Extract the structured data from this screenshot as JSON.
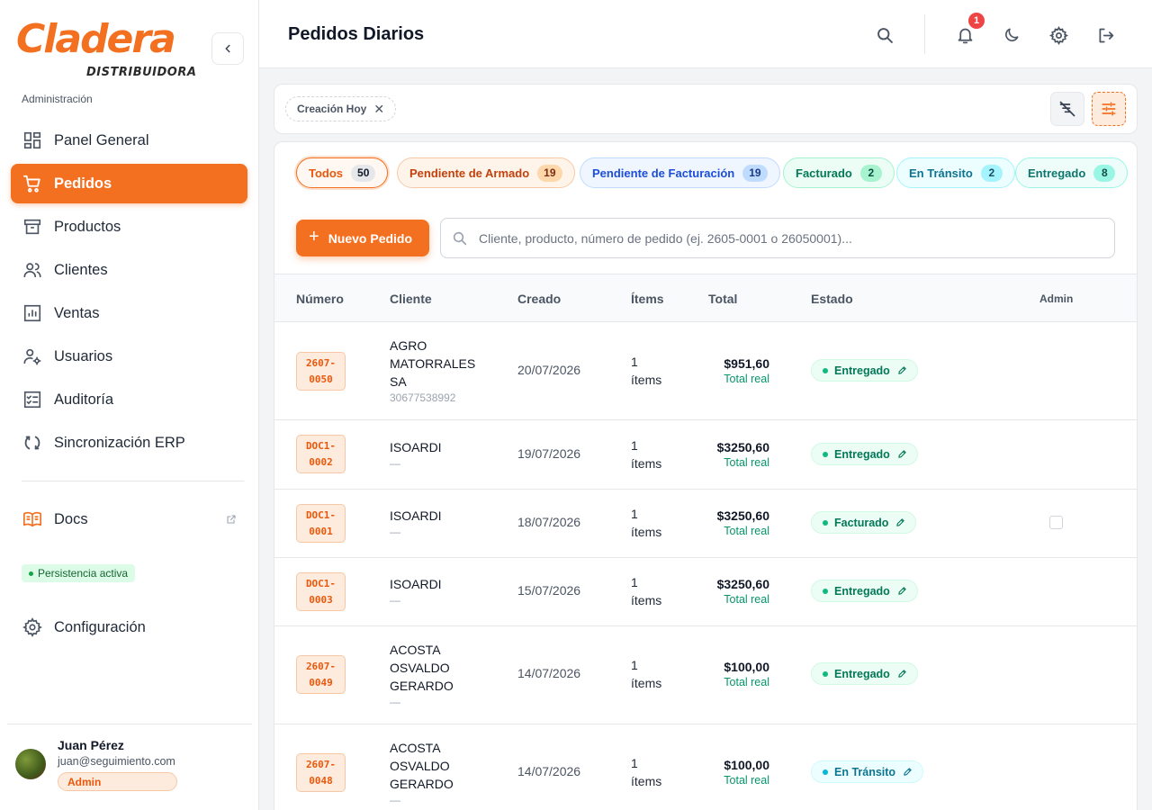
{
  "brand": {
    "name": "Cladera",
    "sub": "DISTRIBUIDORA"
  },
  "sidebar": {
    "section_label": "Administración",
    "items": [
      {
        "label": "Panel General",
        "icon": "dashboard-icon"
      },
      {
        "label": "Pedidos",
        "icon": "cart-icon",
        "active": true
      },
      {
        "label": "Productos",
        "icon": "archive-icon"
      },
      {
        "label": "Clientes",
        "icon": "users-icon"
      },
      {
        "label": "Ventas",
        "icon": "chart-icon"
      },
      {
        "label": "Usuarios",
        "icon": "user-gear-icon"
      },
      {
        "label": "Auditoría",
        "icon": "checklist-icon"
      },
      {
        "label": "Sincronización ERP",
        "icon": "sync-icon"
      }
    ],
    "docs": {
      "label": "Docs",
      "icon": "book-icon"
    },
    "persist_badge": "Persistencia activa",
    "config": {
      "label": "Configuración",
      "icon": "gear-icon"
    }
  },
  "user": {
    "name": "Juan Pérez",
    "email": "juan@seguimiento.com",
    "role": "Admin"
  },
  "header": {
    "title": "Pedidos Diarios",
    "notifications": "1"
  },
  "filters": {
    "chip": "Creación Hoy"
  },
  "tabs": [
    {
      "label": "Todos",
      "count": "50"
    },
    {
      "label": "Pendiente de Armado",
      "count": "19"
    },
    {
      "label": "Pendiente de Facturación",
      "count": "19"
    },
    {
      "label": "Facturado",
      "count": "2"
    },
    {
      "label": "En Tránsito",
      "count": "2"
    },
    {
      "label": "Entregado",
      "count": "8"
    }
  ],
  "actions": {
    "new_order": "Nuevo Pedido",
    "search_placeholder": "Cliente, producto, número de pedido (ej. 2605-0001 o 26050001)..."
  },
  "table": {
    "columns": {
      "numero": "Número",
      "cliente": "Cliente",
      "creado": "Creado",
      "items": "Ítems",
      "total": "Total",
      "estado": "Estado",
      "admin": "Admin"
    },
    "rows": [
      {
        "num1": "2607-",
        "num2": "0050",
        "client": [
          "AGRO",
          "MATORRALES",
          "SA"
        ],
        "client_sub": "30677538992",
        "created": "20/07/2026",
        "items1": "1",
        "items2": "ítems",
        "total": "$951,60",
        "total_label": "Total real",
        "status": "Entregado"
      },
      {
        "num1": "DOC1-",
        "num2": "0002",
        "client": [
          "ISOARDI"
        ],
        "client_sub": "—",
        "created": "19/07/2026",
        "items1": "1",
        "items2": "ítems",
        "total": "$3250,60",
        "total_label": "Total real",
        "status": "Entregado"
      },
      {
        "num1": "DOC1-",
        "num2": "0001",
        "client": [
          "ISOARDI"
        ],
        "client_sub": "—",
        "created": "18/07/2026",
        "items1": "1",
        "items2": "ítems",
        "total": "$3250,60",
        "total_label": "Total real",
        "status": "Facturado"
      },
      {
        "num1": "DOC1-",
        "num2": "0003",
        "client": [
          "ISOARDI"
        ],
        "client_sub": "—",
        "created": "15/07/2026",
        "items1": "1",
        "items2": "ítems",
        "total": "$3250,60",
        "total_label": "Total real",
        "status": "Entregado"
      },
      {
        "num1": "2607-",
        "num2": "0049",
        "client": [
          "ACOSTA",
          "OSVALDO",
          "GERARDO"
        ],
        "client_sub": "—",
        "created": "14/07/2026",
        "items1": "1",
        "items2": "ítems",
        "total": "$100,00",
        "total_label": "Total real",
        "status": "Entregado"
      },
      {
        "num1": "2607-",
        "num2": "0048",
        "client": [
          "ACOSTA",
          "OSVALDO",
          "GERARDO"
        ],
        "client_sub": "—",
        "created": "14/07/2026",
        "items1": "1",
        "items2": "ítems",
        "total": "$100,00",
        "total_label": "Total real",
        "status": "En Tránsito"
      }
    ]
  },
  "colors": {
    "accent": "#f37021",
    "success": "#10b981",
    "info": "#06b6d4"
  }
}
